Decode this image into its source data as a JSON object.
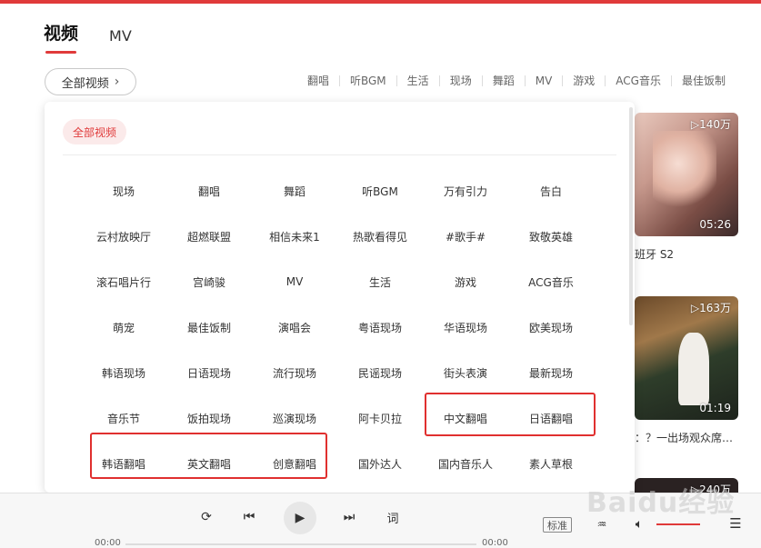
{
  "header": {
    "tabs": [
      {
        "label": "视频",
        "active": true
      },
      {
        "label": "MV",
        "active": false
      }
    ]
  },
  "all_videos_button": {
    "label": "全部视频",
    "chevron": "chevron-right-icon"
  },
  "category_bar": [
    "翻唱",
    "听BGM",
    "生活",
    "现场",
    "舞蹈",
    "MV",
    "游戏",
    "ACG音乐",
    "最佳饭制"
  ],
  "panel": {
    "selected_chip": "全部视频",
    "categories": [
      "现场",
      "翻唱",
      "舞蹈",
      "听BGM",
      "万有引力",
      "告白",
      "云村放映厅",
      "超燃联盟",
      "相信未来1",
      "热歌看得见",
      "#歌手#",
      "致敬英雄",
      "滚石唱片行",
      "宫崎骏",
      "MV",
      "生活",
      "游戏",
      "ACG音乐",
      "萌宠",
      "最佳饭制",
      "演唱会",
      "粤语现场",
      "华语现场",
      "欧美现场",
      "韩语现场",
      "日语现场",
      "流行现场",
      "民谣现场",
      "街头表演",
      "最新现场",
      "音乐节",
      "饭拍现场",
      "巡演现场",
      "阿卡贝拉",
      "中文翻唱",
      "日语翻唱",
      "韩语翻唱",
      "英文翻唱",
      "创意翻唱",
      "国外达人",
      "国内音乐人",
      "素人草根"
    ]
  },
  "videos": [
    {
      "count": "▷140万",
      "duration": "05:26",
      "caption": "班牙 S2"
    },
    {
      "count": "▷163万",
      "duration": "01:19",
      "caption": "：？一出场观众席…"
    },
    {
      "count": "▷240万",
      "duration": "",
      "caption": ""
    }
  ],
  "player": {
    "time_current": "00:00",
    "time_total": "00:00",
    "lyric_label": "词",
    "quality_label": "标准",
    "icons": {
      "repeat": "repeat-icon",
      "prev": "skip-previous-icon",
      "play": "play-icon",
      "next": "skip-next-icon",
      "volume": "volume-icon",
      "playlist": "playlist-icon",
      "effect": "sound-effect-icon"
    }
  },
  "colors": {
    "accent": "#e03a3a",
    "highlight_box": "#e0302f"
  }
}
